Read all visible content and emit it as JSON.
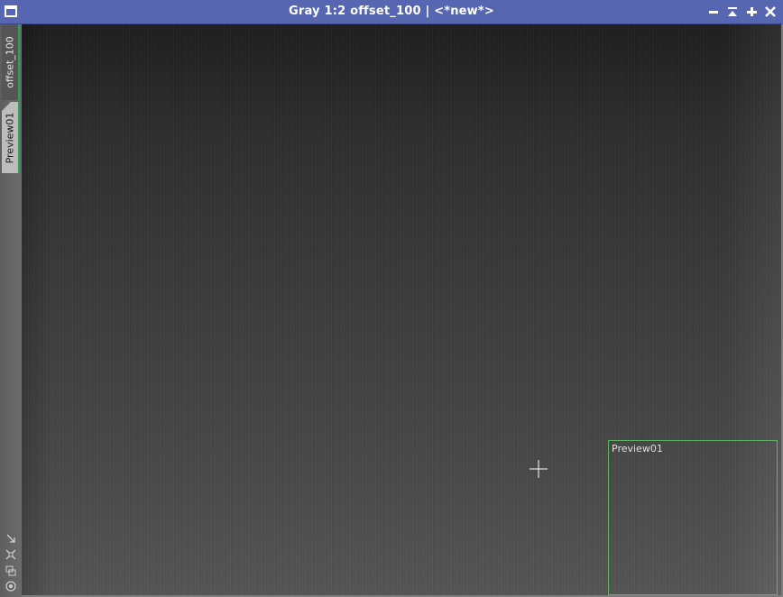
{
  "window": {
    "title": "Gray 1:2 offset_100 | <*new*>",
    "controls": [
      "minimize-icon",
      "shade-icon",
      "maximize-icon",
      "close-icon"
    ]
  },
  "tabs": [
    {
      "label": "offset_100",
      "active": true
    },
    {
      "label": "Preview01",
      "active": false
    }
  ],
  "toolbar_icons": [
    "fit-view-icon",
    "zoom-to-fit-icon",
    "clone-icon",
    "settings-icon"
  ],
  "preview": {
    "label": "Preview01",
    "border_color": "#5fb25f"
  },
  "colors": {
    "titlebar": "#5666b0",
    "tab_accent": "#27a35a"
  }
}
